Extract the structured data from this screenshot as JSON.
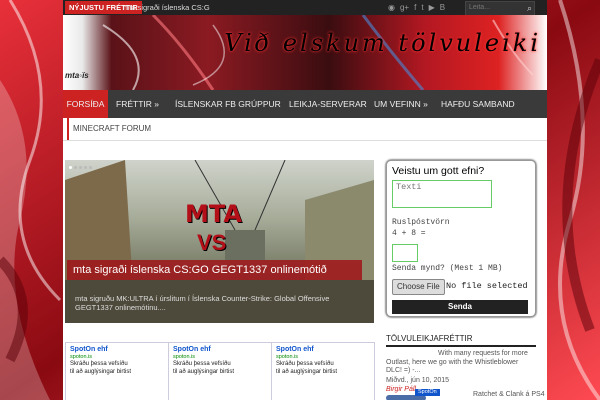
{
  "topbar": {
    "breaking_label": "NÝJUSTU FRÉTTIR",
    "breaking_text": "mta sigraði íslenska CS:G",
    "social_icons": [
      "rss-icon",
      "google-plus-icon",
      "facebook-icon",
      "twitter-icon",
      "youtube-icon",
      "blogger-icon"
    ],
    "social_glyphs": [
      "◉",
      "g+",
      "f",
      "t",
      "▶",
      "B"
    ],
    "search_placeholder": "Leita..."
  },
  "banner": {
    "title": "Við elskum tölvuleiki",
    "logo_text": "mta◦ïs"
  },
  "nav": {
    "items": [
      {
        "label": "Forsíða",
        "active": true
      },
      {
        "label": "Fréttir »"
      },
      {
        "label": "Íslenskar FB grúppur"
      },
      {
        "label": "Leikja-Serverar"
      },
      {
        "label": "Um vefinn »"
      },
      {
        "label": "Hafðu Samband"
      }
    ],
    "row2": [
      "Minecraft Forum"
    ]
  },
  "slider": {
    "title": "mta sigraði íslenska CS:GO GEGT1337 onlinemótið",
    "excerpt": "mta sigruðu MK:ULTRA í úrslitum í Íslenska Counter-Strike: Global Offensive GEGT1337 onlinemótinu....",
    "image_text_1": "MTA",
    "image_text_2": "VS"
  },
  "widget": {
    "title": "Veistu um gott efni?",
    "textarea_placeholder": "Texti",
    "spam_label": "Ruslpóstvörn",
    "spam_question": "4 + 8 =",
    "image_label": "Senda mynd? (Mest 1 MB)",
    "file_button": "Choose File",
    "file_status": "No file selected",
    "send_button": "Senda"
  },
  "gaming_news": {
    "heading": "Tölvuleikjafréttir",
    "text": "With many requests for more Outlast, here we go with the Whistleblower DLC! =) -...",
    "author": "Birgir Páll",
    "date": "Miðvd., jún 10, 2015",
    "next_item": "Ratchet & Clank á PS4 -"
  },
  "ads": [
    {
      "title": "SpotOn ehf",
      "url": "spoton.is",
      "line1": "Skráðu þessa vefsíðu",
      "line2": "til að auglýsingar birtist"
    },
    {
      "title": "SpotOn ehf",
      "url": "spoton.is",
      "line1": "Skráðu þessa vefsíðu",
      "line2": "til að auglýsingar birtist"
    },
    {
      "title": "SpotOn ehf",
      "url": "spoton.is",
      "line1": "Skráðu þessa vefsíðu",
      "line2": "til að auglýsingar birtist"
    }
  ],
  "ads_badge": "SpotOn",
  "colors": {
    "accent": "#cc2222",
    "nav": "#3a3a3a",
    "background": "#b3101a"
  }
}
